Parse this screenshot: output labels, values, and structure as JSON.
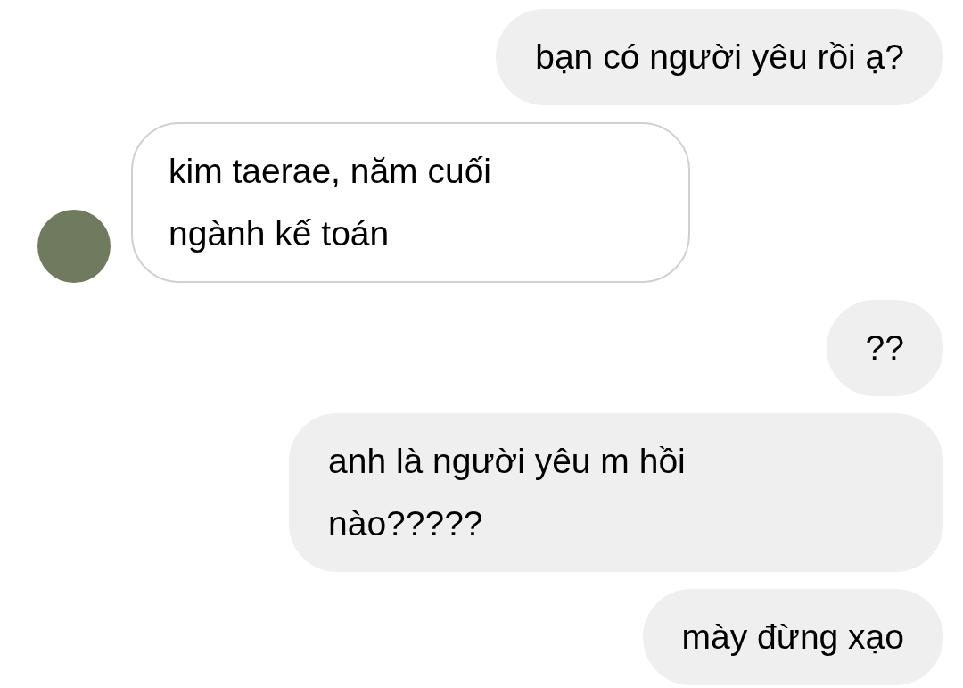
{
  "messages": [
    {
      "kind": "sent",
      "lines": [
        "bạn có người yêu rồi ạ?"
      ]
    },
    {
      "kind": "received",
      "lines": [
        "kim taerae, năm cuối",
        "ngành kế toán"
      ]
    },
    {
      "kind": "sent",
      "lines": [
        "??"
      ]
    },
    {
      "kind": "sent",
      "lines": [
        "anh là người yêu m hồi",
        "nào?????"
      ]
    },
    {
      "kind": "sent",
      "lines": [
        "mày đừng xạo"
      ]
    }
  ]
}
